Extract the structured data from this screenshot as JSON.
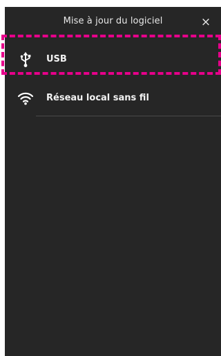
{
  "header": {
    "title": "Mise à jour du logiciel",
    "close_symbol": "×"
  },
  "items": [
    {
      "label": "USB",
      "icon": "usb-icon"
    },
    {
      "label": "Réseau local sans fil",
      "icon": "wifi-icon"
    }
  ],
  "colors": {
    "background": "#262626",
    "text": "#f2f2f2",
    "highlight": "#e6008a"
  }
}
